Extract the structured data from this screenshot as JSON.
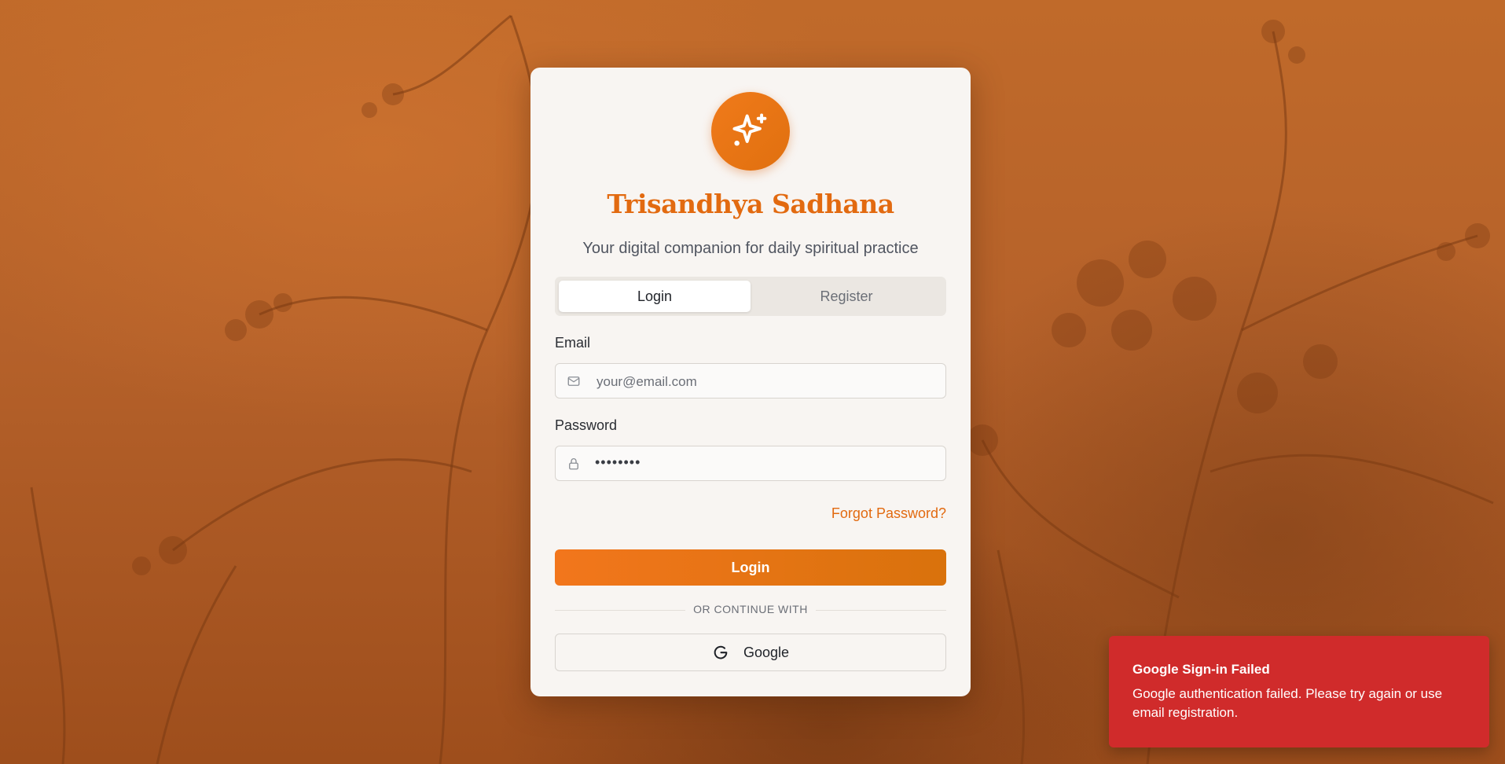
{
  "app": {
    "title": "Trisandhya Sadhana",
    "subtitle": "Your digital companion for daily spiritual practice",
    "logo_icon": "sparkles-icon"
  },
  "tabs": [
    {
      "label": "Login",
      "active": true
    },
    {
      "label": "Register",
      "active": false
    }
  ],
  "form": {
    "email": {
      "label": "Email",
      "placeholder": "your@email.com",
      "value": "",
      "icon": "mail-icon"
    },
    "password": {
      "label": "Password",
      "masked_value": "••••••••",
      "icon": "lock-icon"
    },
    "forgot_label": "Forgot Password?",
    "submit_label": "Login",
    "divider_label": "OR CONTINUE WITH",
    "google_label": "Google"
  },
  "toast": {
    "title": "Google Sign-in Failed",
    "message": "Google authentication failed. Please try again or use email registration."
  },
  "colors": {
    "accent": "#e26a10",
    "error": "#d02b2b",
    "card": "#f8f5f2"
  }
}
